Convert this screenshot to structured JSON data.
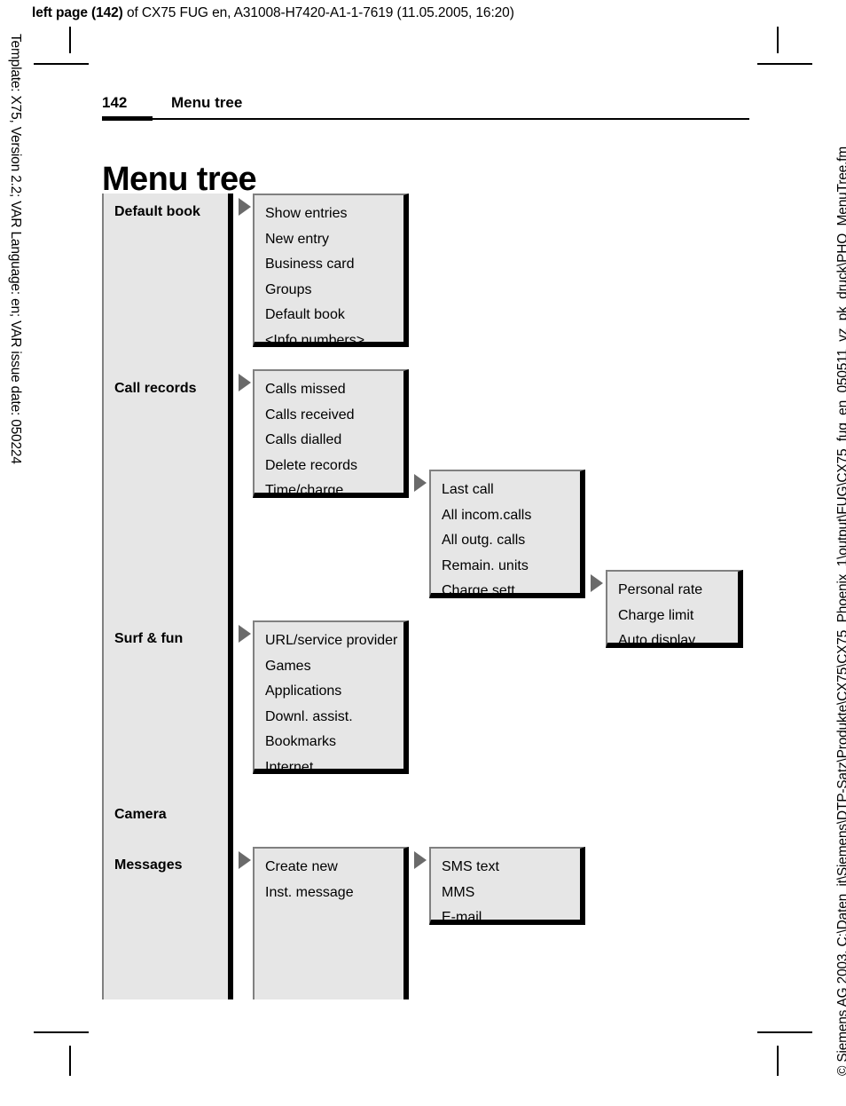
{
  "doc_header": {
    "bold_part": "left page (142)",
    "rest_part": " of CX75 FUG en, A31008-H7420-A1-1-7619 (11.05.2005, 16:20)"
  },
  "margins": {
    "left_vertical": "Template: X75, Version 2.2; VAR Language: en; VAR issue date: 050224",
    "right_vertical": "© Siemens AG 2003, C:\\Daten_it\\Siemens\\DTP-Satz\\Produkte\\CX75\\CX75_Phoenix_1\\output\\FUG\\CX75_fug_en_050511_vz_pk_druck\\PHO_MenuTree.fm"
  },
  "page_header": {
    "page_number": "142",
    "section": "Menu tree"
  },
  "page_title": "Menu tree",
  "menu_tree": {
    "level1": [
      {
        "label": "Default book"
      },
      {
        "label": "Call records"
      },
      {
        "label": "Surf & fun"
      },
      {
        "label": "Camera"
      },
      {
        "label": "Messages"
      }
    ],
    "default_book": [
      "Show entries",
      "New entry",
      "Business card",
      "Groups",
      "Default book",
      "<Info numbers>"
    ],
    "call_records": [
      "Calls missed",
      "Calls received",
      "Calls dialled",
      "Delete records",
      "Time/charge"
    ],
    "time_charge": [
      "Last call",
      "All incom.calls",
      "All outg. calls",
      "Remain. units",
      "Charge sett."
    ],
    "charge_sett": [
      "Personal rate",
      "Charge limit",
      "Auto display"
    ],
    "surf_fun": [
      "URL/service provider",
      "Games",
      "Applications",
      "Downl. assist.",
      "Bookmarks",
      "Internet"
    ],
    "messages": [
      "Create new",
      "",
      "",
      "Inst. message"
    ],
    "create_new": [
      "SMS text",
      "MMS",
      "E-mail"
    ]
  },
  "colors": {
    "box_fill": "#e6e6e6",
    "box_shadow": "#000000",
    "box_edge": "#808080",
    "arrow": "#6a6a6a"
  }
}
